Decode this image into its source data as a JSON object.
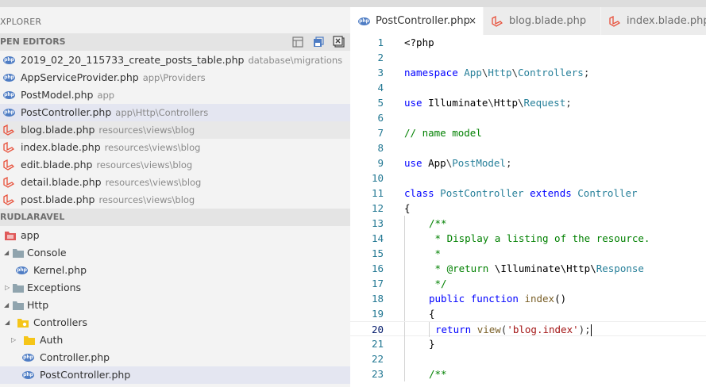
{
  "explorer": {
    "title": "XPLORER",
    "open_editors_header": "PEN EDITORS",
    "open_editors": [
      {
        "name": "2019_02_20_115733_create_posts_table.php",
        "path": "database\\migrations",
        "icon": "php-icon"
      },
      {
        "name": "AppServiceProvider.php",
        "path": "app\\Providers",
        "icon": "php-icon"
      },
      {
        "name": "PostModel.php",
        "path": "app",
        "icon": "php-icon"
      },
      {
        "name": "PostController.php",
        "path": "app\\Http\\Controllers",
        "icon": "php-icon"
      },
      {
        "name": "blog.blade.php",
        "path": "resources\\views\\blog",
        "icon": "blade-icon"
      },
      {
        "name": "index.blade.php",
        "path": "resources\\views\\blog",
        "icon": "blade-icon"
      },
      {
        "name": "edit.blade.php",
        "path": "resources\\views\\blog",
        "icon": "blade-icon"
      },
      {
        "name": "detail.blade.php",
        "path": "resources\\views\\blog",
        "icon": "blade-icon"
      },
      {
        "name": "post.blade.php",
        "path": "resources\\views\\blog",
        "icon": "blade-icon"
      }
    ],
    "project_header": "RUDLARAVEL",
    "tree": [
      {
        "name": "app",
        "icon": "folder-app-icon"
      },
      {
        "name": "Console",
        "icon": "folder-icon"
      },
      {
        "name": "Kernel.php",
        "icon": "php-icon"
      },
      {
        "name": "Exceptions",
        "icon": "folder-icon"
      },
      {
        "name": "Http",
        "icon": "folder-icon"
      },
      {
        "name": "Controllers",
        "icon": "folder-controllers-icon"
      },
      {
        "name": "Auth",
        "icon": "folder-yellow-icon"
      },
      {
        "name": "Controller.php",
        "icon": "php-icon"
      },
      {
        "name": "PostController.php",
        "icon": "php-icon"
      }
    ]
  },
  "tabs": [
    {
      "label": "PostController.php",
      "icon": "php-icon",
      "active": true,
      "close": "×"
    },
    {
      "label": "blog.blade.php",
      "icon": "blade-icon",
      "active": false
    },
    {
      "label": "index.blade.php",
      "icon": "blade-icon",
      "active": false
    }
  ],
  "php_icon_text": "php",
  "line_numbers": [
    "1",
    "2",
    "3",
    "4",
    "5",
    "6",
    "7",
    "8",
    "9",
    "10",
    "11",
    "12",
    "13",
    "14",
    "15",
    "16",
    "17",
    "18",
    "19",
    "20",
    "21",
    "22",
    "23"
  ],
  "code": {
    "l1": "<?php",
    "l3_kw": "namespace",
    "l3_a": "App",
    "l3_b": "Http",
    "l3_c": "Controllers",
    "l5_kw": "use",
    "l5_a": "Illuminate",
    "l5_b": "Http",
    "l5_c": "Request",
    "l7": "// name model",
    "l9_kw": "use",
    "l9_a": "App",
    "l9_b": "PostModel",
    "l11_kw1": "class",
    "l11_name": "PostController",
    "l11_kw2": "extends",
    "l11_base": "Controller",
    "l12": "{",
    "l13": "/**",
    "l14": " * Display a listing of the resource.",
    "l15": " *",
    "l16_a": " * @return",
    "l16_b": "\\Illuminate\\Http\\",
    "l16_c": "Response",
    "l17": " */",
    "l18_kw1": "public",
    "l18_kw2": "function",
    "l18_fn": "index",
    "l18_p": "()",
    "l19": "{",
    "l20_kw": "return",
    "l20_fn": "view",
    "l20_str": "'blog.index'",
    "l21": "}",
    "l23": "/**"
  },
  "colors": {
    "keyword": "#0000ff",
    "type": "#267f99",
    "comment": "#008000",
    "string": "#a31515",
    "function": "#795e26",
    "php_badge": "#4f7dc4",
    "laravel": "#e8503a"
  }
}
